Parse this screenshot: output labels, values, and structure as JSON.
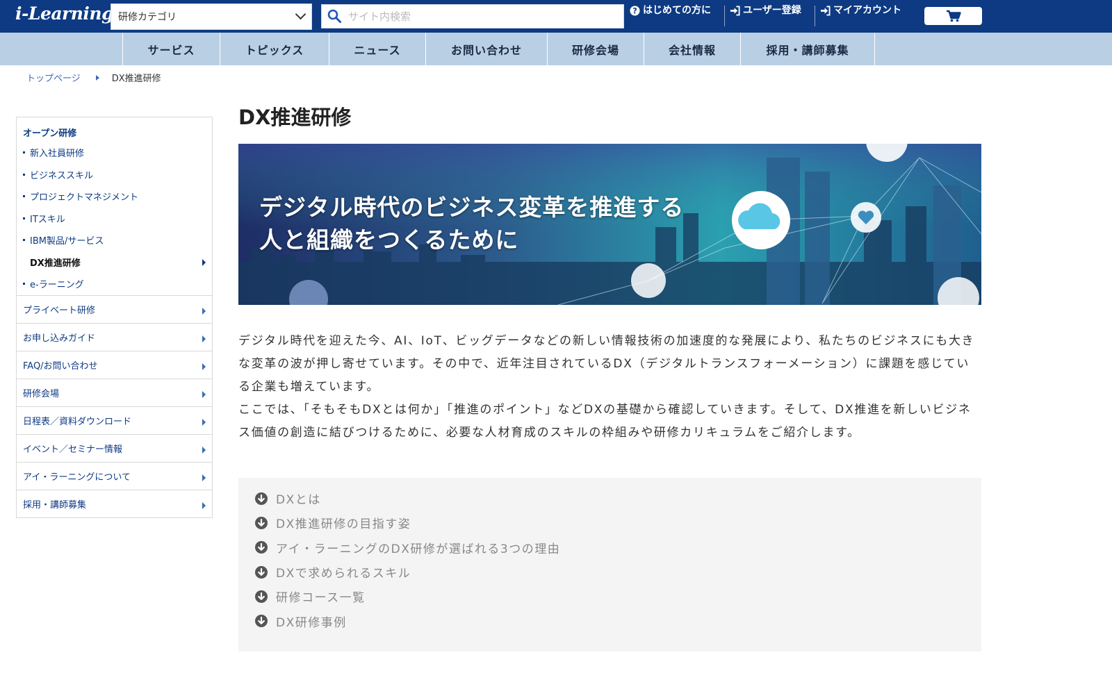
{
  "header": {
    "logo": "i-Learning",
    "category_select": "研修カテゴリ",
    "search_placeholder": "サイト内検索",
    "links": [
      {
        "label": "はじめての方に",
        "icon": "question-circle-icon"
      },
      {
        "label": "ユーザー登録",
        "icon": "sign-in-icon"
      },
      {
        "label": "マイアカウント",
        "icon": "sign-in-icon"
      }
    ],
    "cart_icon": "cart-icon"
  },
  "nav": [
    "サービス",
    "トピックス",
    "ニュース",
    "お問い合わせ",
    "研修会場",
    "会社情報",
    "採用・講師募集"
  ],
  "breadcrumb": {
    "home": "トップページ",
    "current": "DX推進研修"
  },
  "sidebar": {
    "heading": "オープン研修",
    "sub_items": [
      {
        "label": "新入社員研修"
      },
      {
        "label": "ビジネススキル"
      },
      {
        "label": "プロジェクトマネジメント"
      },
      {
        "label": "ITスキル"
      },
      {
        "label": "IBM製品/サービス"
      },
      {
        "label": "DX推進研修",
        "active": true
      },
      {
        "label": "e-ラーニング"
      }
    ],
    "sections": [
      "プライベート研修",
      "お申し込みガイド",
      "FAQ/お問い合わせ",
      "研修会場",
      "日程表／資料ダウンロード",
      "イベント／セミナー情報",
      "アイ・ラーニングについて",
      "採用・講師募集"
    ]
  },
  "main": {
    "title": "DX推進研修",
    "banner_lines": [
      "デジタル時代のビジネス変革を推進する",
      "人と組織をつくるために"
    ],
    "intro_1": "デジタル時代を迎えた今、AI、IoT、ビッグデータなどの新しい情報技術の加速度的な発展により、私たちのビジネスにも大きな変革の波が押し寄せています。その中で、近年注目されているDX（デジタルトランスフォーメーション）に課題を感じている企業も増えています。",
    "intro_2": "ここでは、「そもそもDXとは何か」「推進のポイント」などDXの基礎から確認していきます。そして、DX推進を新しいビジネス価値の創造に結びつけるために、必要な人材育成のスキルの枠組みや研修カリキュラムをご紹介します。",
    "toc": [
      "DXとは",
      "DX推進研修の目指す姿",
      "アイ・ラーニングのDX研修が選ばれる3つの理由",
      "DXで求められるスキル",
      "研修コース一覧",
      "DX研修事例"
    ]
  },
  "colors": {
    "header_bg": "#0d3a82",
    "nav_bg": "#b9cfe4",
    "link": "#0d3a82",
    "toc_bg": "#f4f4f4"
  }
}
